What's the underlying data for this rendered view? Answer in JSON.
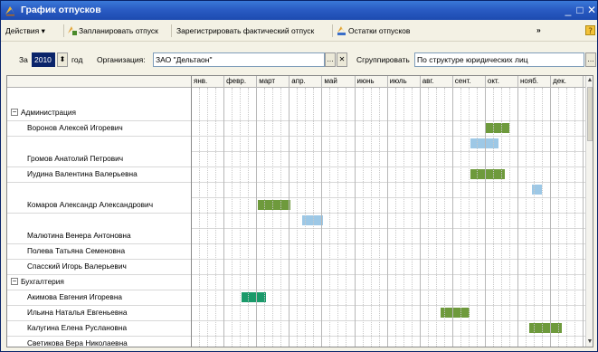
{
  "window": {
    "title": "График отпусков"
  },
  "toolbar": {
    "actions": "Действия",
    "plan_vacation": "Запланировать отпуск",
    "register_actual": "Зарегистрировать фактический отпуск",
    "vacation_balance": "Остатки отпусков",
    "more": "»"
  },
  "filter": {
    "year_prefix": "За",
    "year_value": "2010",
    "year_suffix": "год",
    "organization_label": "Организация:",
    "organization_value": "ЗАО \"Дельтаон\"",
    "group_label": "Сгруппировать",
    "group_value": "По структуре юридических лиц"
  },
  "months": [
    "янв.",
    "февр.",
    "март",
    "апр.",
    "май",
    "июнь",
    "июль",
    "авг.",
    "сент.",
    "окт.",
    "нояб.",
    "дек."
  ],
  "colors": {
    "plan": "#6e9a3c",
    "fact": "#9dc8e6",
    "plan_alt": "#1a9a6a"
  },
  "rows": [
    {
      "kind": "group",
      "label": "Администрация"
    },
    {
      "kind": "emp",
      "label": "Воронов Алексей Игоревич",
      "bars": [
        {
          "type": "plan",
          "start": 9.0,
          "end": 9.75
        }
      ]
    },
    {
      "kind": "sub",
      "label": "",
      "bars": [
        {
          "type": "fact",
          "start": 8.55,
          "end": 9.4
        }
      ]
    },
    {
      "kind": "emp",
      "label": "Громов Анатолий Петрович",
      "bars": []
    },
    {
      "kind": "emp",
      "label": "Иудина Валентина Валерьевна",
      "bars": [
        {
          "type": "plan",
          "start": 8.55,
          "end": 9.6
        }
      ]
    },
    {
      "kind": "sub",
      "label": "",
      "bars": [
        {
          "type": "fact",
          "start": 10.45,
          "end": 10.75
        }
      ]
    },
    {
      "kind": "emp",
      "label": "Комаров Александр Александрович",
      "bars": [
        {
          "type": "plan",
          "start": 2.05,
          "end": 3.05
        }
      ]
    },
    {
      "kind": "sub",
      "label": "",
      "bars": [
        {
          "type": "fact",
          "start": 3.4,
          "end": 4.05
        }
      ]
    },
    {
      "kind": "emp",
      "label": "Малютина Венера Антоновна",
      "bars": []
    },
    {
      "kind": "emp",
      "label": "Полева Татьяна Семеновна",
      "bars": []
    },
    {
      "kind": "emp",
      "label": "Спасский Игорь Валерьевич",
      "bars": []
    },
    {
      "kind": "group",
      "label": "Бухгалтерия"
    },
    {
      "kind": "emp",
      "label": "Акимова Евгения Игоревна",
      "bars": [
        {
          "type": "plan_alt",
          "start": 1.55,
          "end": 2.3
        }
      ]
    },
    {
      "kind": "emp",
      "label": "Ильина Наталья Евгеньевна",
      "bars": [
        {
          "type": "plan",
          "start": 7.65,
          "end": 8.55
        }
      ]
    },
    {
      "kind": "emp",
      "label": "Калугина Елена Руслановна",
      "bars": [
        {
          "type": "plan",
          "start": 10.35,
          "end": 11.35
        }
      ]
    },
    {
      "kind": "emp",
      "label": "Светикова Вера Николаевна",
      "bars": []
    }
  ]
}
